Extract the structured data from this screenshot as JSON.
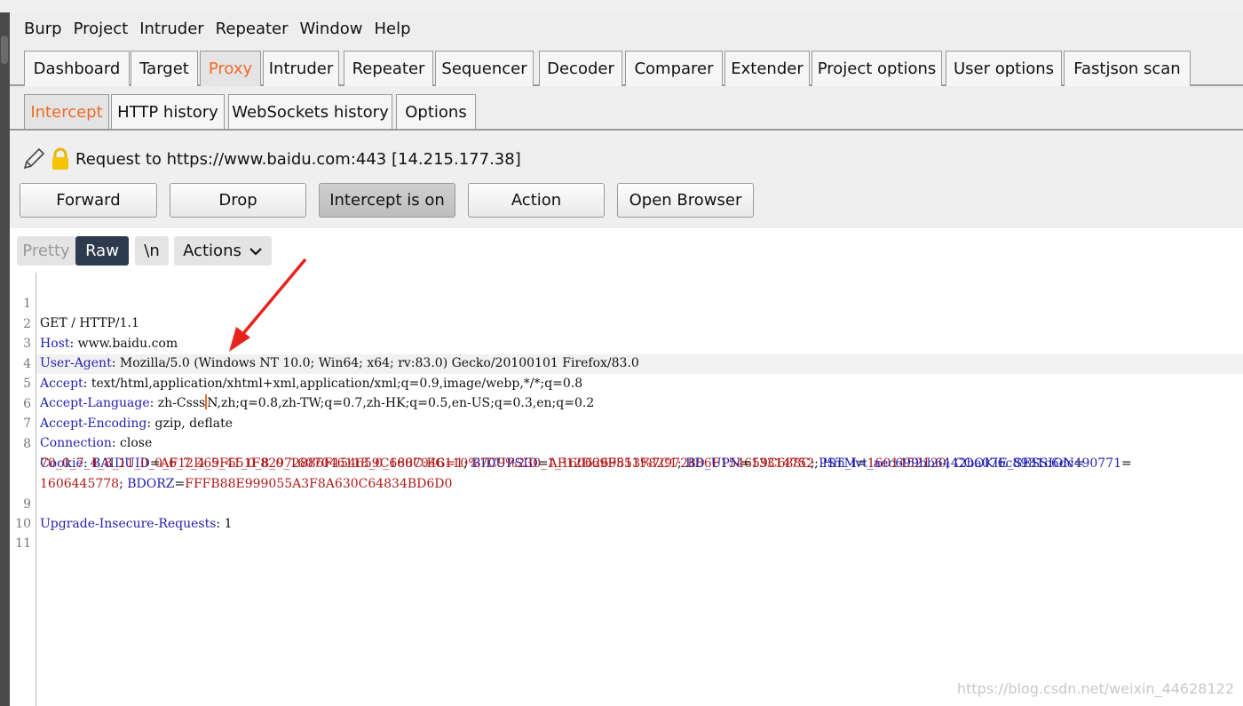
{
  "menu": [
    "Burp",
    "Project",
    "Intruder",
    "Repeater",
    "Window",
    "Help"
  ],
  "main_tabs": [
    "Dashboard",
    "Target",
    "Proxy",
    "Intruder",
    "Repeater",
    "Sequencer",
    "Decoder",
    "Comparer",
    "Extender",
    "Project options",
    "User options",
    "Fastjson scan"
  ],
  "sub_tabs": [
    "Intercept",
    "HTTP history",
    "WebSockets history",
    "Options"
  ],
  "request_label": "Request to https://www.baidu.com:443  [14.215.177.38]",
  "buttons": {
    "forward": "Forward",
    "drop": "Drop",
    "intercept": "Intercept is on",
    "action": "Action",
    "open_browser": "Open Browser"
  },
  "toolbar": {
    "pretty": "Pretty",
    "raw": "Raw",
    "newline": "\\n",
    "actions": "Actions"
  },
  "lines": {
    "l1": "GET / HTTP/1.1",
    "l2k": "Host",
    "l2v": ": www.baidu.com",
    "l3k": "User-Agent",
    "l3v": ": Mozilla/5.0 (Windows NT 10.0; Win64; x64; rv:83.0) Gecko/20100101 Firefox/83.0",
    "l4k": "Accept",
    "l4v": ": text/html,application/xhtml+xml,application/xml;q=0.9,image/webp,*/*;q=0.8",
    "l5k": "Accept-Language",
    "l5va": ": zh-Csss",
    "l5vb": "N,zh;q=0.8,zh-TW;q=0.7,zh-HK;q=0.5,en-US;q=0.3,en;q=0.2",
    "l6k": "Accept-Encoding",
    "l6v": ": gzip, deflate",
    "l7k": "Connection",
    "l7v": ": close",
    "l8k": "Cookie",
    "c1k": "BAIDUID",
    "c1v": "AF12D69F551F82972886F154659C688C:FG=1",
    "c2k": "BIDUPSID",
    "c2v": "AF12D69F551F82972886F154659C688C",
    "c3k": "PSTM",
    "c3v": "1601452120",
    "c4k": "COOKIE_SESSION",
    "c4v": "70_0_7_4_8_11_0_0_6_7_4_5_41_0_8_0_1607046118_0_1607046110%7C9%230_1_1606269813%7C1",
    "c5k": "BD_UPN",
    "c5v": "13314752",
    "c6k": "Hm_lvt_aec699bb6442ba076c8981c6dc490771",
    "c6v": "1606445778",
    "c7k": "BDORZ",
    "c7v": "FFFB88E999055A3F8A630C64834BD6D0",
    "l9k": "Upgrade-Insecure-Requests",
    "l9v": ": 1"
  },
  "watermark": "https://blog.csdn.net/weixin_44628122"
}
